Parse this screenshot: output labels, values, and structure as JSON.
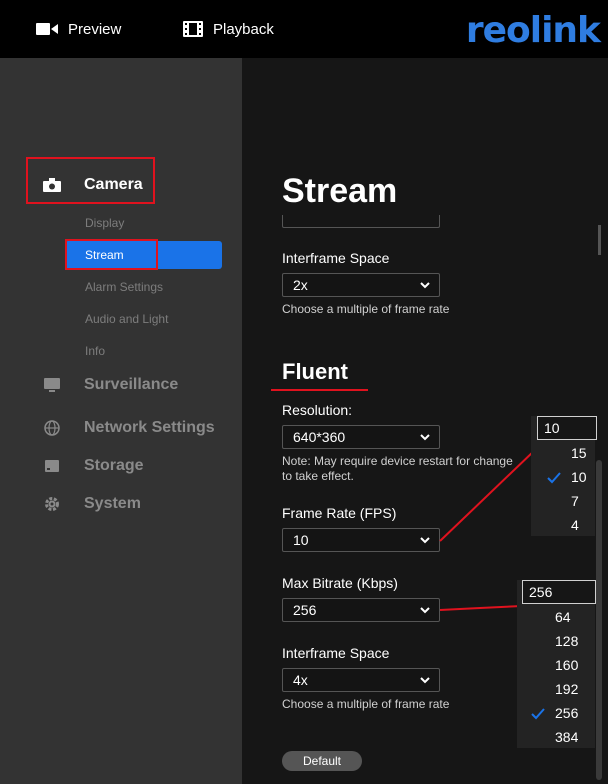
{
  "topbar": {
    "preview_label": "Preview",
    "playback_label": "Playback",
    "logo_text": "reolink",
    "logo_color": "#2f7de1"
  },
  "sidebar": {
    "camera": {
      "label": "Camera",
      "icon": "camera-icon"
    },
    "sub_items": [
      "Display",
      "Stream",
      "Alarm Settings",
      "Audio and Light",
      "Info"
    ],
    "active_sub": "Stream",
    "categories": [
      {
        "label": "Surveillance",
        "icon": "monitor-icon"
      },
      {
        "label": "Network Settings",
        "icon": "globe-icon"
      },
      {
        "label": "Storage",
        "icon": "storage-icon"
      },
      {
        "label": "System",
        "icon": "gear-icon"
      }
    ],
    "accent_color": "#1a73e8"
  },
  "main": {
    "page_title": "Stream",
    "clear": {
      "interframe_label": "Interframe Space",
      "interframe_value": "2x",
      "interframe_hint": "Choose a multiple of frame rate"
    },
    "fluent": {
      "section_title": "Fluent",
      "resolution_label": "Resolution:",
      "resolution_value": "640*360",
      "resolution_note_1": "Note: May require device restart for change",
      "resolution_note_2": "to take effect.",
      "framerate_label": "Frame Rate (FPS)",
      "framerate_value": "10",
      "bitrate_label": "Max Bitrate (Kbps)",
      "bitrate_value": "256",
      "interframe_label": "Interframe Space",
      "interframe_value": "4x",
      "interframe_hint": "Choose a multiple of frame rate"
    },
    "default_button": "Default"
  },
  "framerate_popup": {
    "current": "10",
    "options": [
      "15",
      "10",
      "7",
      "4"
    ],
    "selected": "10"
  },
  "bitrate_popup": {
    "current": "256",
    "options": [
      "64",
      "128",
      "160",
      "192",
      "256",
      "384"
    ],
    "selected": "256"
  },
  "annotation_color": "#e0121e"
}
